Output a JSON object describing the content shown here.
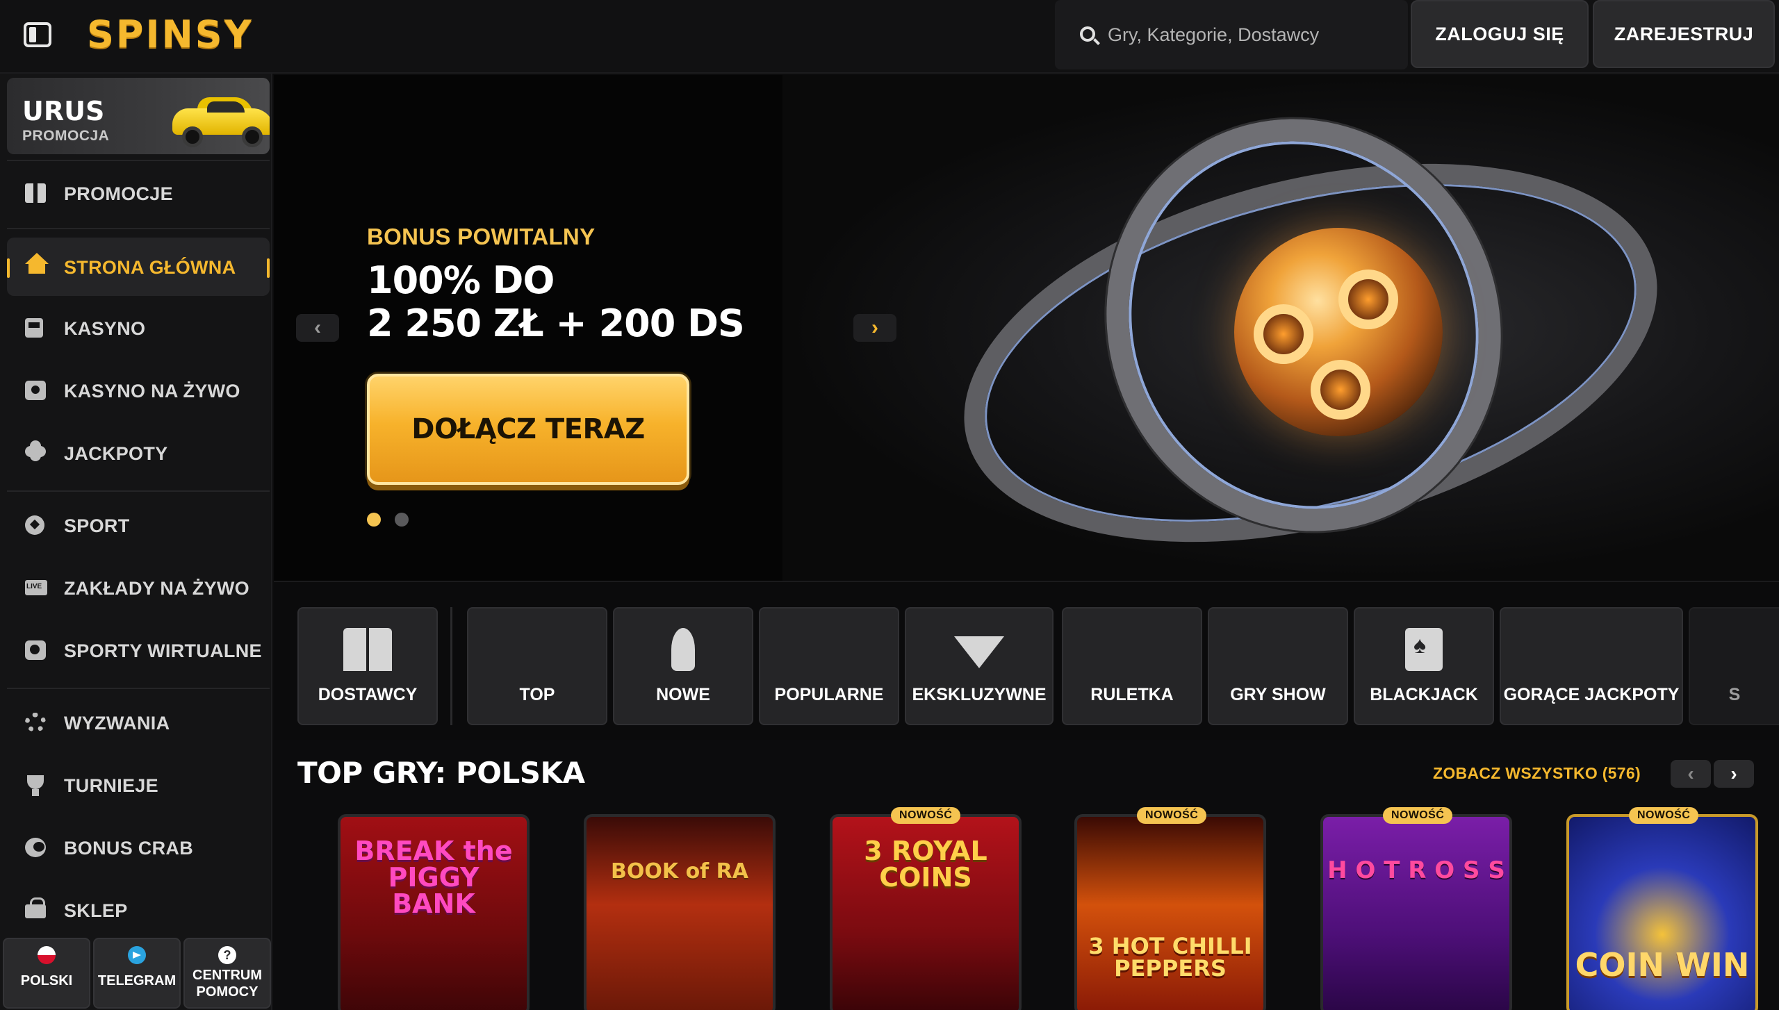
{
  "app": {
    "logo": "SPINSY"
  },
  "search": {
    "placeholder": "Gry, Kategorie, Dostawcy"
  },
  "auth": {
    "login": "ZALOGUJ SIĘ",
    "register": "ZAREJESTRUJ"
  },
  "sidebar": {
    "promo_card": {
      "title": "URUS",
      "subtitle": "PROMOCJA"
    },
    "items": [
      {
        "label": "PROMOCJE",
        "icon": "gift-icon"
      },
      {
        "label": "STRONA GŁÓWNA",
        "icon": "home-icon",
        "active": true
      },
      {
        "label": "KASYNO",
        "icon": "slot-machine-icon"
      },
      {
        "label": "KASYNO NA ŻYWO",
        "icon": "live-casino-icon"
      },
      {
        "label": "JACKPOTY",
        "icon": "clover-icon"
      },
      {
        "label": "SPORT",
        "icon": "football-icon"
      },
      {
        "label": "ZAKŁADY NA ŻYWO",
        "icon": "live-bets-icon"
      },
      {
        "label": "SPORTY WIRTUALNE",
        "icon": "virtual-sports-icon"
      },
      {
        "label": "WYZWANIA",
        "icon": "gear-icon"
      },
      {
        "label": "TURNIEJE",
        "icon": "trophy-icon"
      },
      {
        "label": "BONUS CRAB",
        "icon": "crab-icon"
      },
      {
        "label": "SKLEP",
        "icon": "shop-icon"
      }
    ],
    "footer": [
      {
        "label": "POLSKI",
        "icon": "poland-flag-icon"
      },
      {
        "label": "TELEGRAM",
        "icon": "telegram-icon"
      },
      {
        "label": "CENTRUM POMOCY",
        "icon": "help-icon",
        "glyph": "?"
      }
    ]
  },
  "hero": {
    "kicker": "BONUS POWITALNY",
    "line1": "100% DO",
    "line2": "2 250 ZŁ + 200 DS",
    "cta": "DOŁĄCZ TERAZ",
    "prev": "‹",
    "next": "›",
    "slides_total": 2,
    "slide_active": 1
  },
  "categories": [
    {
      "label": "DOSTAWCY",
      "icon": "book-icon"
    },
    {
      "label": "TOP",
      "icon": ""
    },
    {
      "label": "NOWE",
      "icon": "rocket-icon"
    },
    {
      "label": "POPULARNE",
      "icon": ""
    },
    {
      "label": "EKSKLUZYWNE",
      "icon": "diamond-icon"
    },
    {
      "label": "RULETKA",
      "icon": ""
    },
    {
      "label": "GRY SHOW",
      "icon": ""
    },
    {
      "label": "BLACKJACK",
      "icon": "cards-icon"
    },
    {
      "label": "GORĄCE JACKPOTY",
      "icon": ""
    },
    {
      "label": "S",
      "icon": ""
    }
  ],
  "top_games": {
    "title": "TOP GRY: POLSKA",
    "see_all": "ZOBACZ WSZYSTKO (576)",
    "prev": "‹",
    "next": "›",
    "games": [
      {
        "title": "BREAK the PIGGY BANK",
        "badge": ""
      },
      {
        "title": "BOOK of RA",
        "badge": ""
      },
      {
        "title": "3 ROYAL COINS",
        "badge": "NOWOŚĆ"
      },
      {
        "title": "3 HOT CHILLI PEPPERS",
        "badge": "NOWOŚĆ"
      },
      {
        "title": "H O T  R O S S",
        "badge": "NOWOŚĆ"
      },
      {
        "title": "COIN WIN",
        "badge": "NOWOŚĆ"
      }
    ]
  },
  "colors": {
    "accent": "#f5b82e",
    "background": "#0c0c0d",
    "panel": "#141415"
  }
}
